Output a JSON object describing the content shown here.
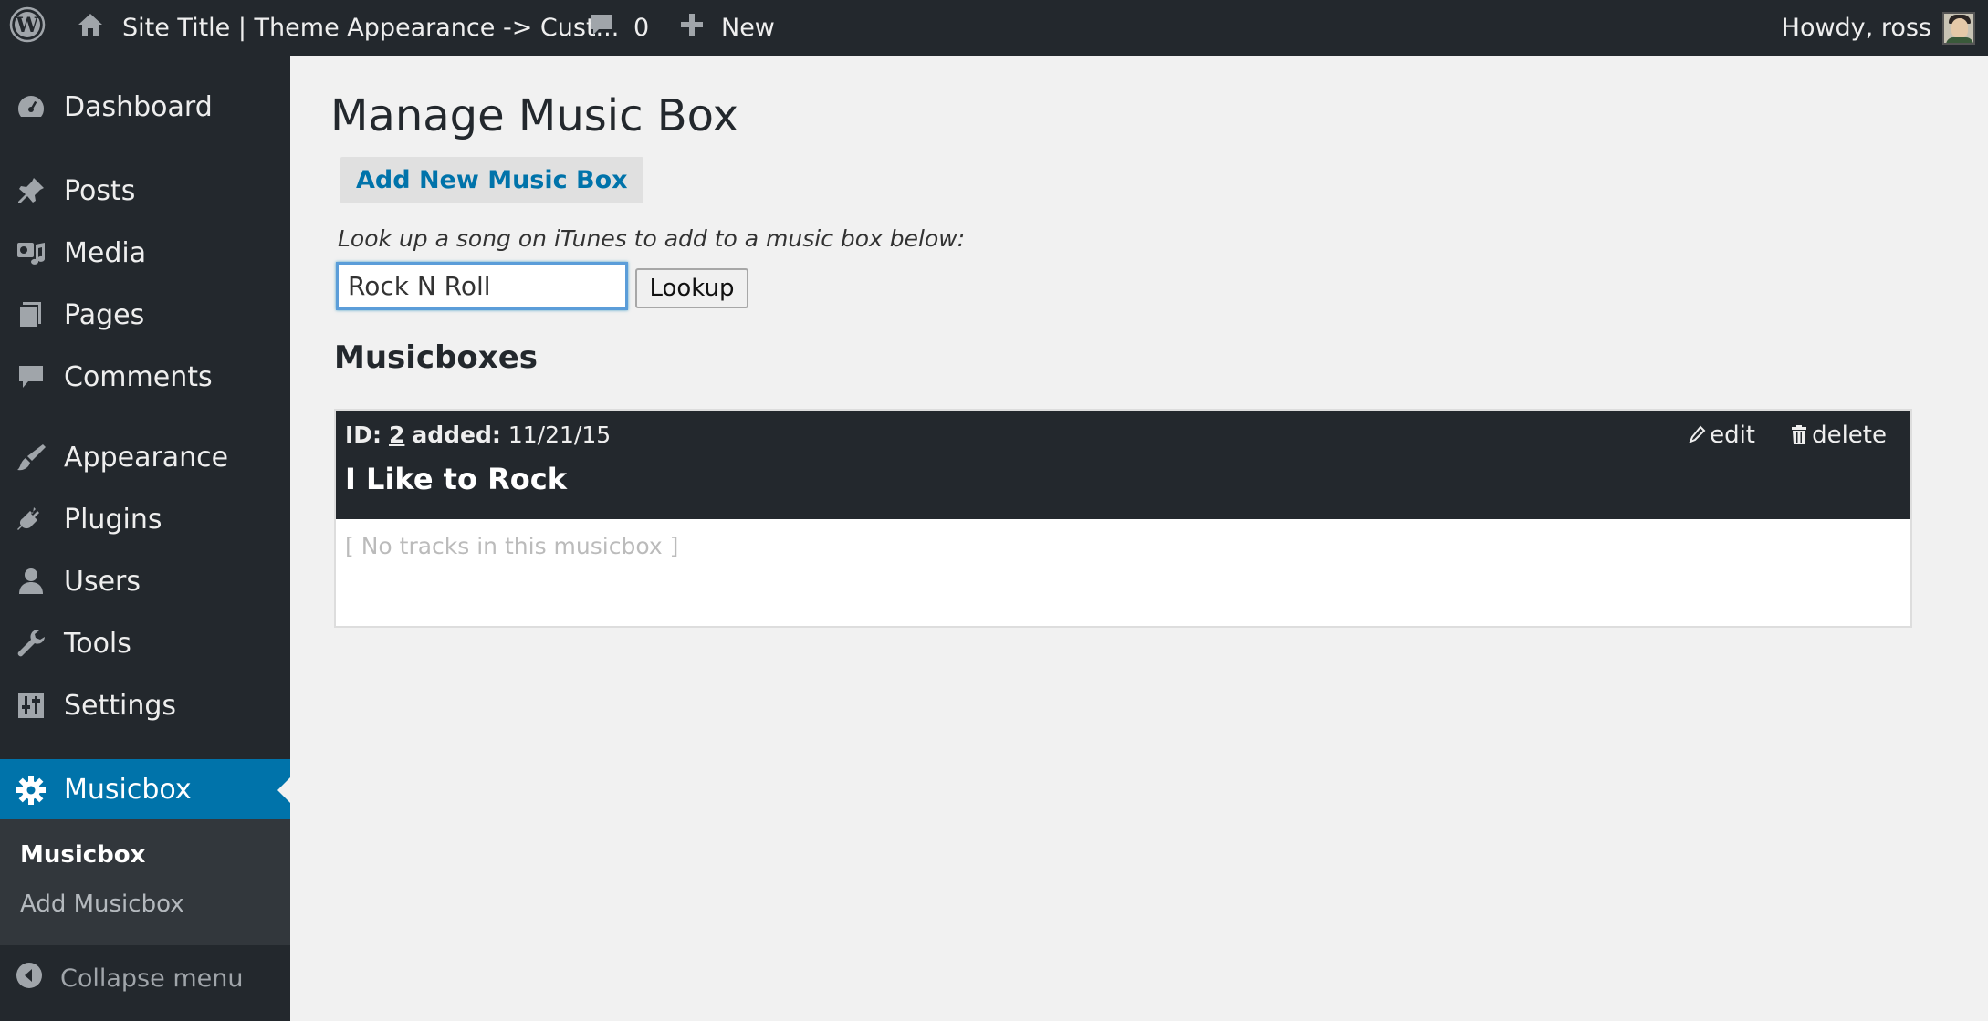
{
  "adminbar": {
    "site_title": "Site Title | Theme Appearance -> Cust...",
    "comments_count": "0",
    "new_label": "New",
    "greeting": "Howdy, ross"
  },
  "sidebar": {
    "items": [
      {
        "label": "Dashboard",
        "icon": "dashboard-icon"
      },
      {
        "label": "Posts",
        "icon": "pin-icon"
      },
      {
        "label": "Media",
        "icon": "media-icon"
      },
      {
        "label": "Pages",
        "icon": "pages-icon"
      },
      {
        "label": "Comments",
        "icon": "comment-icon"
      },
      {
        "label": "Appearance",
        "icon": "brush-icon"
      },
      {
        "label": "Plugins",
        "icon": "plug-icon"
      },
      {
        "label": "Users",
        "icon": "user-icon"
      },
      {
        "label": "Tools",
        "icon": "wrench-icon"
      },
      {
        "label": "Settings",
        "icon": "settings-sliders-icon"
      },
      {
        "label": "Musicbox",
        "icon": "gear-icon",
        "current": true
      }
    ],
    "submenu": [
      {
        "label": "Musicbox",
        "current": true
      },
      {
        "label": "Add Musicbox"
      }
    ],
    "collapse_label": "Collapse menu"
  },
  "main": {
    "title": "Manage Music Box",
    "add_new_label": "Add New Music Box",
    "lookup_label": "Look up a song on iTunes to add to a music box below:",
    "lookup_value": "Rock N Roll",
    "lookup_button": "Lookup",
    "section_title": "Musicboxes",
    "musicbox": {
      "id_label": "ID:",
      "id": "2",
      "added_label": "added:",
      "added_date": "11/21/15",
      "title": "I Like to Rock",
      "edit_label": "edit",
      "delete_label": "delete",
      "empty_text": "[ No tracks in this musicbox ]"
    }
  },
  "colors": {
    "admin_dark": "#23282d",
    "accent_blue": "#0073aa",
    "background": "#f1f1f1"
  }
}
